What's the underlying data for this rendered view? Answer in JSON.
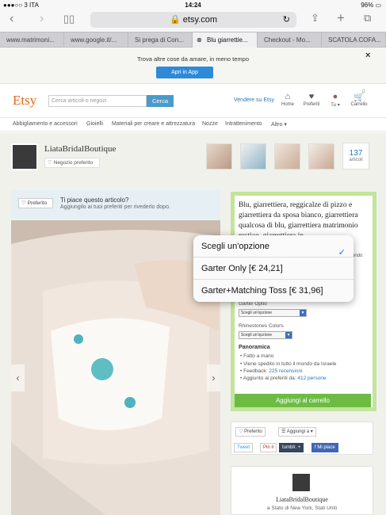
{
  "status": {
    "carrier": "●●●○○ 3 ITA",
    "time": "14:24",
    "battery": "96%"
  },
  "safari": {
    "url": "etsy.com"
  },
  "tabs": [
    "www.matrimoni...",
    "www.google.it/...",
    "Si prega di Con...",
    "Blu giarrettie...",
    "Checkout - Mo...",
    "SCATOLA COFA..."
  ],
  "banner": {
    "text": "Trova altre cose da amare, in meno tempo",
    "button": "Apri in App",
    "close": "×"
  },
  "header": {
    "logo": "Etsy",
    "search_placeholder": "Cerca articoli o negozi",
    "search_button": "Cerca",
    "sell": "Vendere su Etsy",
    "home": "Home",
    "favorites": "Preferiti",
    "you": "Tu ▾",
    "cart": "Carrello",
    "cart_count": "0"
  },
  "categories": [
    "Abbigliamento e accessori",
    "Gioielli",
    "Materiali per creare e attrezzatura",
    "Nozze",
    "Intrattenimento",
    "Altro ▾"
  ],
  "shop": {
    "name": "LiataBridalBoutique",
    "favorite": "Negozio preferito",
    "count": "137",
    "count_label": "articoli"
  },
  "favorite_panel": {
    "button": "Preferito",
    "title": "Ti piace questo articolo?",
    "subtitle": "Aggiungilo ai tuoi preferiti per rivederlo dopo."
  },
  "listing": {
    "title": "Blu, giarrettiera, reggicalze di pizzo e giarrettiera da sposa bianco, giarrettiera qualcosa di blu, giarrettiera matrimonio rustico, giarrettiera in",
    "option_labels": [
      "Garter Optio",
      "Rhinestones Colors"
    ],
    "option_placeholder": "Scegli un'opzione",
    "partial_text": "ondo",
    "overview_title": "Panoramica",
    "overview": [
      {
        "text": "Fatto a mano",
        "link": ""
      },
      {
        "text": "Viene spedito in tutto il mondo da Israele",
        "link": ""
      },
      {
        "text": "Feedback: ",
        "link": "225 recensioni"
      },
      {
        "text": "Aggiunto ai preferiti da: ",
        "link": "412 persone"
      }
    ],
    "cart_button": "Aggiungi al carrello"
  },
  "social": {
    "favorite": "Preferito",
    "add_to": "Aggiungi a ▾",
    "tweet": "Tweet",
    "pin": "Pin it",
    "tumblr": "tumblr. +",
    "fb": "Mi piace"
  },
  "shopcard": {
    "name": "LiataBridalBoutique",
    "location": "a Stato di New York, Stati Uniti"
  },
  "popover": {
    "options": [
      "Scegli un'opzione",
      "Garter Only [€ 24,21]",
      "Garter+Matching Toss [€ 31,96]"
    ],
    "selected_index": 0
  }
}
